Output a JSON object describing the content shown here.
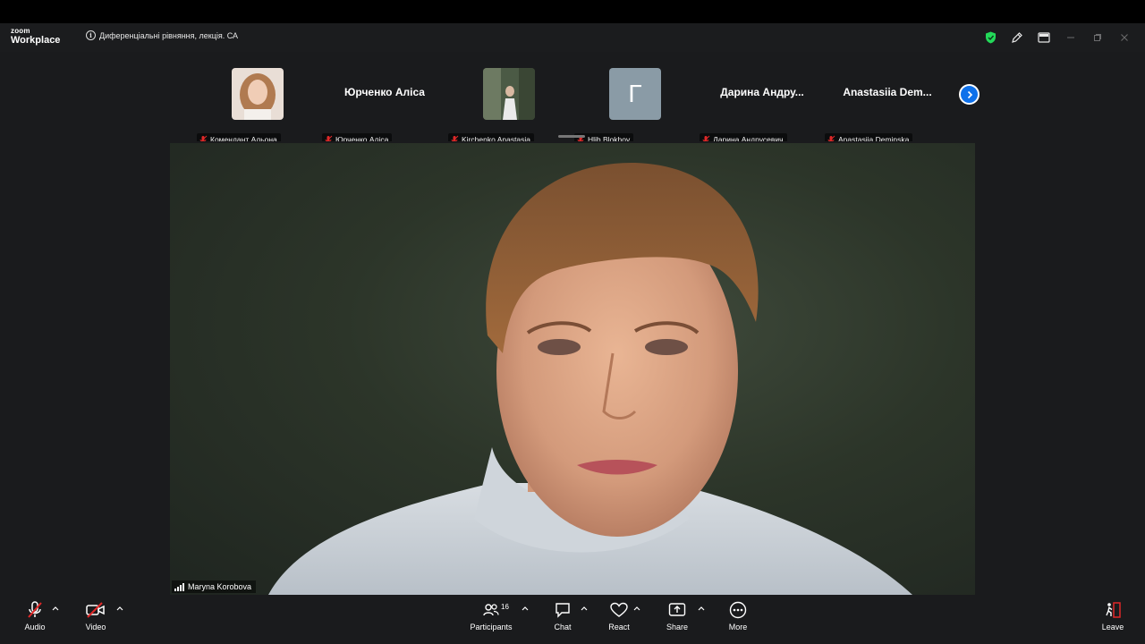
{
  "app": {
    "brand_small": "zoom",
    "brand_large": "Workplace",
    "meeting_title": "Диференціальні рівняння, лекція. СА"
  },
  "colors": {
    "accent": "#0e71eb",
    "shield": "#23d959",
    "muted_red": "#e02828",
    "toolbar_bg": "#1a1b1d"
  },
  "participants": [
    {
      "display": "photo",
      "label": "Комендант Альона",
      "muted": true
    },
    {
      "display": "name",
      "big_name": "Юрченко Аліса",
      "label": "Юрченко Аліса",
      "muted": true
    },
    {
      "display": "photo",
      "label": "Kirchenko Anastasia",
      "muted": true
    },
    {
      "display": "initial",
      "initial": "Г",
      "label": "Hlib Blokhov",
      "muted": true
    },
    {
      "display": "name",
      "big_name": "Дарина  Андру...",
      "label": "Дарина Андрусевич",
      "muted": true
    },
    {
      "display": "name",
      "big_name": "Anastasiia  Dem...",
      "label": "Anastasiia Deminska",
      "muted": true
    }
  ],
  "speaker": {
    "name": "Maryna Korobova"
  },
  "toolbar": {
    "audio_label": "Audio",
    "video_label": "Video",
    "participants_label": "Participants",
    "participants_count": "16",
    "chat_label": "Chat",
    "react_label": "React",
    "share_label": "Share",
    "more_label": "More",
    "leave_label": "Leave"
  }
}
